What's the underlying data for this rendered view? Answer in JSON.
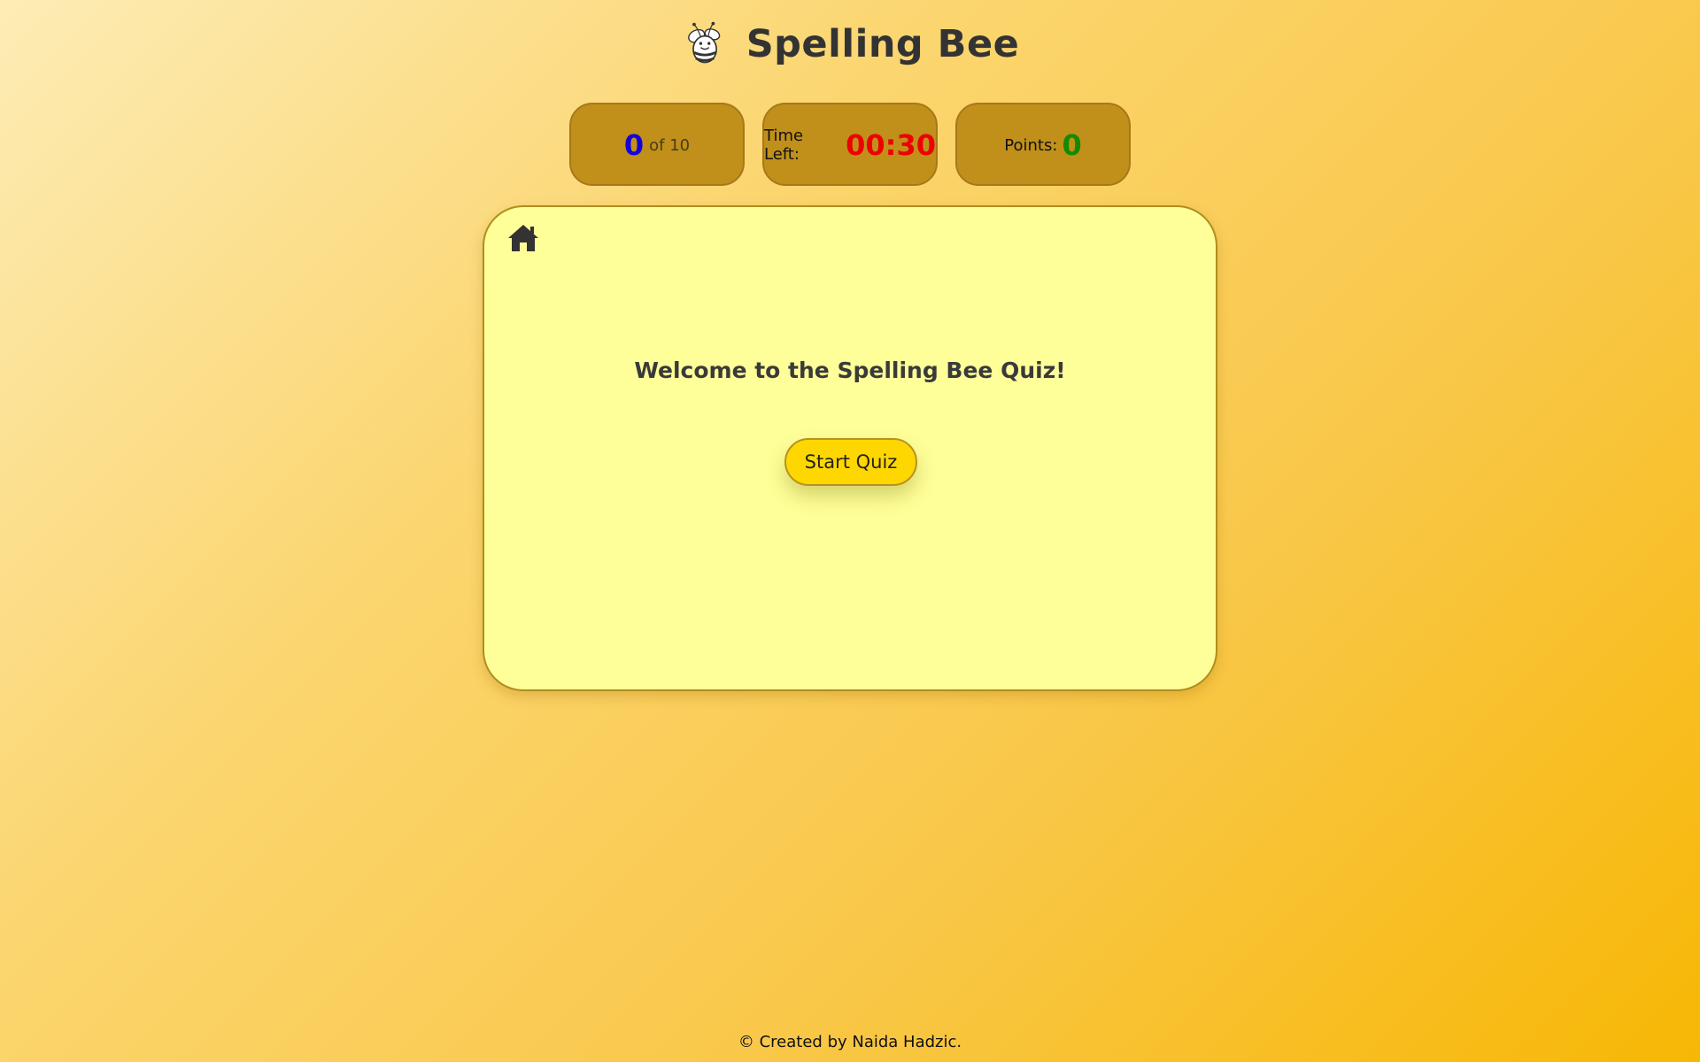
{
  "header": {
    "title": "Spelling Bee",
    "logo_icon": "bee-icon"
  },
  "stats": {
    "question_current": "0",
    "question_total_text": "of 10",
    "time_label": "Time Left:",
    "time_value": "00:30",
    "points_label": "Points:",
    "points_value": "0"
  },
  "card": {
    "home_icon": "home-icon",
    "welcome_text": "Welcome to the Spelling Bee Quiz!",
    "start_button_label": "Start Quiz"
  },
  "footer": {
    "text": "© Created by Naida Hadzic."
  },
  "colors": {
    "question_current": "#1500dd",
    "time_value": "#ee0000",
    "points_value": "#138a00",
    "stat_box_bg": "#c0901a",
    "card_bg": "#ffff99",
    "start_button_bg": "#ffd700"
  }
}
